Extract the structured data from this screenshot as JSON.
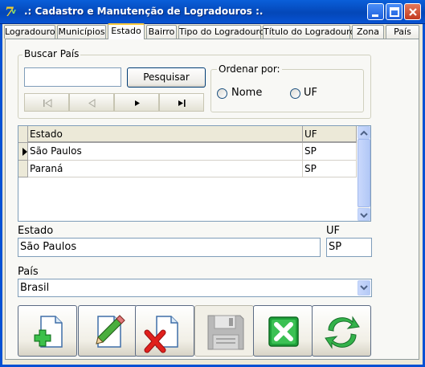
{
  "window": {
    "title": ".: Cadastro e Manutenção de Logradouros :."
  },
  "tabs": [
    {
      "label": "Logradouro"
    },
    {
      "label": "Municípios"
    },
    {
      "label": "Estado"
    },
    {
      "label": "Bairro"
    },
    {
      "label": "Tipo do Logradouro"
    },
    {
      "label": "Título do Logradouro"
    },
    {
      "label": "Zona"
    },
    {
      "label": "País"
    }
  ],
  "active_tab": "Estado",
  "search": {
    "group_label": "Buscar País",
    "input_value": "",
    "button_label": "Pesquisar",
    "nav": [
      "first-icon",
      "prev-icon",
      "next-icon",
      "last-icon"
    ]
  },
  "order": {
    "group_label": "Ordenar por:",
    "options": [
      {
        "label": "Nome",
        "selected": false
      },
      {
        "label": "UF",
        "selected": false
      }
    ]
  },
  "grid": {
    "columns": [
      "Estado",
      "UF"
    ],
    "rows": [
      {
        "estado": "São Paulos",
        "uf": "SP",
        "current": true
      },
      {
        "estado": "Paraná",
        "uf": "SP",
        "current": false
      }
    ]
  },
  "form": {
    "estado_label": "Estado",
    "estado_value": "São Paulos",
    "uf_label": "UF",
    "uf_value": "SP",
    "pais_label": "País",
    "pais_value": "Brasil"
  },
  "actions": [
    {
      "icon": "new-document-icon",
      "enabled": true
    },
    {
      "icon": "edit-pencil-icon",
      "enabled": true
    },
    {
      "icon": "delete-document-icon",
      "enabled": true
    },
    {
      "icon": "save-disk-icon",
      "enabled": false
    },
    {
      "icon": "cancel-x-icon",
      "enabled": true
    },
    {
      "icon": "refresh-icon",
      "enabled": true
    }
  ],
  "colors": {
    "titlebar": "#0A5FD9",
    "active_tab_accent": "#FFC83C",
    "cancel_green": "#1FA23A",
    "delete_red": "#E0201C"
  }
}
